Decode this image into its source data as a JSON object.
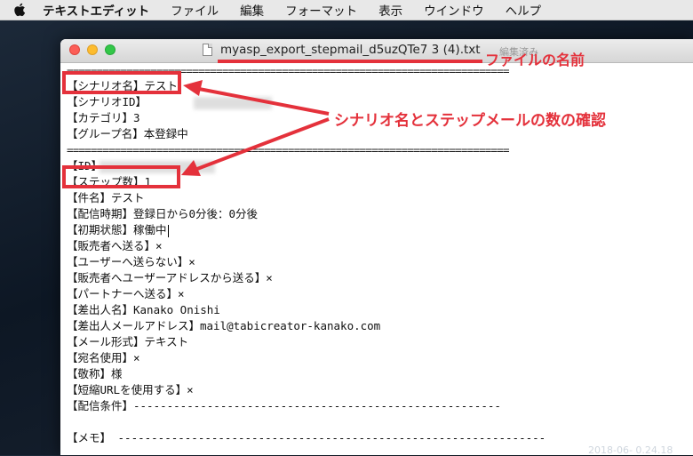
{
  "menubar": {
    "items": [
      "テキストエディット",
      "ファイル",
      "編集",
      "フォーマット",
      "表示",
      "ウインドウ",
      "ヘルプ"
    ]
  },
  "window": {
    "title": "myasp_export_stepmail_d5uzQTe7 3 (4).txt",
    "edited_label": "編集済み"
  },
  "document": {
    "lines": [
      "==========================================================================",
      "【シナリオ名】テスト",
      "【シナリオID】",
      "【カテゴリ】3",
      "【グループ名】本登録中",
      "==========================================================================",
      "【ID】",
      "【ステップ数】1",
      "【件名】テスト",
      "【配信時期】登録日から0分後：0分後",
      "【初期状態】稼働中",
      "【販売者へ送る】×",
      "【ユーザーへ送らない】×",
      "【販売者へユーザーアドレスから送る】×",
      "【パートナーへ送る】×",
      "【差出人名】Kanako Onishi",
      "【差出人メールアドレス】mail@tabicreator-kanako.com",
      "【メール形式】テキスト",
      "【宛名使用】×",
      "【敬称】様",
      "【短縮URLを使用する】×",
      "【配信条件】-------------------------------------------------------",
      "",
      "【メモ】 ----------------------------------------------------------------"
    ]
  },
  "annotations": {
    "filename_label": "ファイルの名前",
    "check_label": "シナリオ名とステップメールの数の確認",
    "color": "#e4313b"
  },
  "desktop": {
    "timestamp": "2018-06- 0.24.18"
  }
}
